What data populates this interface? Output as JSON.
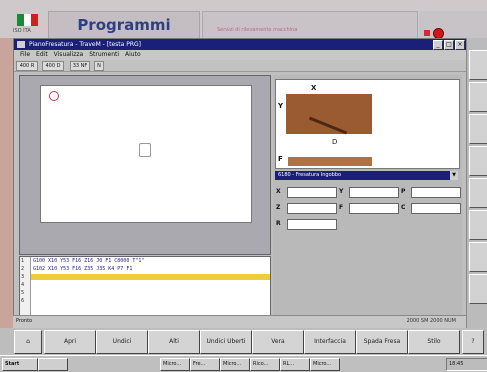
{
  "header": {
    "language": "ISO ITA",
    "title": "Programmi",
    "message": "Servizi di rilevamento macchina",
    "flag_colors": [
      "#1a8a3a",
      "#ffffff",
      "#cc2222"
    ]
  },
  "window": {
    "title": "PianoFresatura - TraveM - [testa PRG]",
    "menu": [
      "File",
      "Edit",
      "Visualizza",
      "Strumenti",
      "Aiuto"
    ],
    "toolbar": [
      "400 R",
      "400 D",
      "33 NF",
      "N"
    ],
    "controls": [
      "_",
      "□",
      "×"
    ]
  },
  "editor": {
    "line_numbers": [
      "1",
      "2",
      "3",
      "4",
      "5",
      "6"
    ],
    "lines": [
      "G100 X10 Y53 F16 Z16 J0 F1 C8000 T\"1\"",
      "G102 X10 Y53 F16 Z35 J35 K4 P7 F1"
    ]
  },
  "tool_diagram": {
    "labels": {
      "x": "X",
      "y": "Y",
      "f": "F",
      "d": "D"
    }
  },
  "operation": {
    "selected": "6180 - Fresatura Ingobbo",
    "dropdown_icon": "▼"
  },
  "params": [
    {
      "label": "X",
      "value": ""
    },
    {
      "label": "Y",
      "value": ""
    },
    {
      "label": "P",
      "value": ""
    },
    {
      "label": "Z",
      "value": ""
    },
    {
      "label": "F",
      "value": ""
    },
    {
      "label": "C",
      "value": ""
    },
    {
      "label": "R",
      "value": ""
    }
  ],
  "status": {
    "left": "Pronto",
    "right": "2000 SM 2000 NUM"
  },
  "function_keys": [
    "Apri",
    "Undici",
    "Alti",
    "Undici Uberti",
    "Vera",
    "Interfaccia",
    "Spada Fresa",
    "Stilo"
  ],
  "taskbar": {
    "start": "Start",
    "tasks": [
      "Micro...",
      "Fre...",
      "Micro...",
      "Rico...",
      "RL...",
      "Micro..."
    ],
    "clock": "18:45"
  },
  "colors": {
    "titlebar": "#1a1f7a",
    "highlight": "#f2cc38",
    "brand_text": "#2f3f86"
  }
}
